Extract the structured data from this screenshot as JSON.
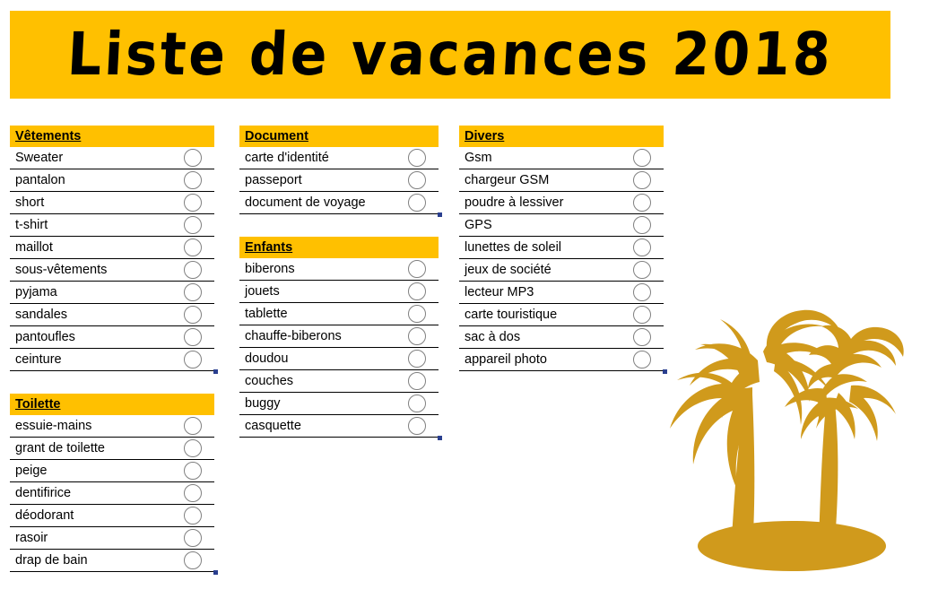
{
  "title": {
    "text": "Liste de vacances 2018",
    "banner_color": "#FFC000",
    "text_color": "#000000"
  },
  "theme": {
    "header_bg": "#FFC000",
    "row_border": "#000000",
    "bubble_border": "#808080",
    "palm_color": "#D09A1C",
    "handle_color": "#2A3F8F"
  },
  "columns": [
    {
      "sections": [
        {
          "heading": "Vêtements",
          "items": [
            "Sweater",
            "pantalon",
            "short",
            "t-shirt",
            "maillot",
            "sous-vêtements",
            "pyjama",
            "sandales",
            "pantoufles",
            "ceinture"
          ]
        },
        {
          "heading": "Toilette",
          "items": [
            "essuie-mains",
            "grant de toilette",
            "peige",
            "dentifirice",
            "déodorant",
            "rasoir",
            "drap de bain"
          ]
        }
      ]
    },
    {
      "sections": [
        {
          "heading": "Document",
          "items": [
            "carte d'identité",
            "passeport",
            "document de voyage"
          ]
        },
        {
          "heading": "Enfants",
          "items": [
            "biberons",
            "jouets",
            "tablette",
            "chauffe-biberons",
            "doudou",
            "couches",
            "buggy",
            "casquette"
          ]
        }
      ]
    },
    {
      "sections": [
        {
          "heading": "Divers",
          "items": [
            "Gsm",
            "chargeur GSM",
            "poudre à lessiver",
            "GPS",
            "lunettes de soleil",
            "jeux de société",
            "lecteur MP3",
            "carte touristique",
            "sac à dos",
            "appareil photo"
          ]
        }
      ]
    }
  ],
  "decoration": {
    "icon": "palm-trees-island-icon"
  }
}
